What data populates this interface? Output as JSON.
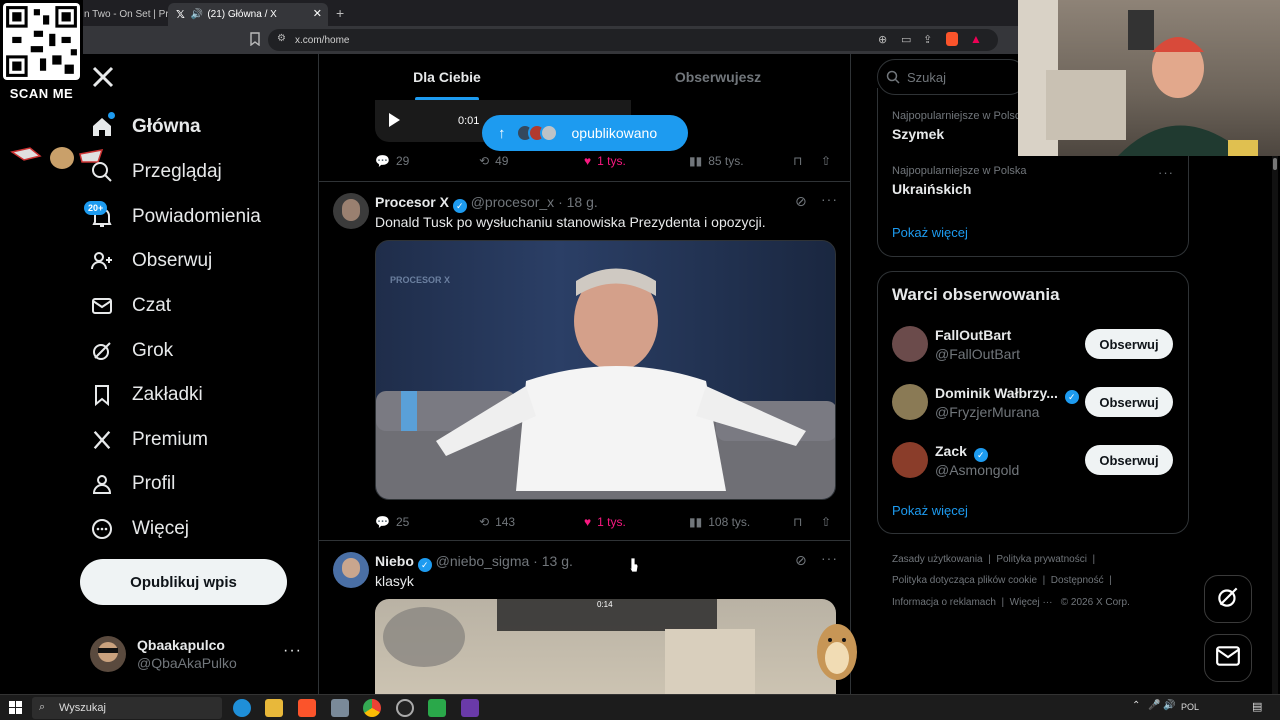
{
  "browser": {
    "tabs": [
      {
        "label": "n Two - On Set | Prin"
      },
      {
        "label": "(21) Główna / X"
      }
    ],
    "url": "x.com/home"
  },
  "overlay": {
    "qr_caption": "SCAN ME"
  },
  "nav": {
    "items": [
      {
        "label": "Główna",
        "icon": "home-icon"
      },
      {
        "label": "Przeglądaj",
        "icon": "search-icon"
      },
      {
        "label": "Powiadomienia",
        "icon": "bell-icon",
        "badge": "20+"
      },
      {
        "label": "Obserwuj",
        "icon": "person-add-icon"
      },
      {
        "label": "Czat",
        "icon": "mail-icon"
      },
      {
        "label": "Grok",
        "icon": "grok-icon"
      },
      {
        "label": "Zakładki",
        "icon": "bookmark-icon"
      },
      {
        "label": "Premium",
        "icon": "x-logo-icon"
      },
      {
        "label": "Profil",
        "icon": "person-icon"
      },
      {
        "label": "Więcej",
        "icon": "more-circle-icon"
      }
    ],
    "post_button": "Opublikuj wpis",
    "account": {
      "name": "Qbaakapulco",
      "handle": "@QbaAkaPulko"
    }
  },
  "feed": {
    "tabs": [
      "Dla Ciebie",
      "Obserwujesz"
    ],
    "new_posts_pill": "opublikowano",
    "audio_time": "0:01",
    "tweets": [
      {
        "replies": "29",
        "reposts": "49",
        "likes": "1 tys.",
        "views": "85 tys."
      },
      {
        "name": "Procesor X",
        "handle": "@procesor_x",
        "time": "18 g.",
        "text": "Donald Tusk po wysłuchaniu stanowiska Prezydenta i opozycji.",
        "watermark": "PROCESOR X",
        "replies": "25",
        "reposts": "143",
        "likes": "1 tys.",
        "views": "108 tys."
      },
      {
        "name": "Niebo",
        "handle": "@niebo_sigma",
        "time": "13 g.",
        "text": "klasyk",
        "game_timer": "0:14"
      }
    ]
  },
  "sidebar": {
    "search_placeholder": "Szukaj",
    "trends": [
      {
        "context": "Najpopularniejsze w Polsce",
        "name": "Szymek"
      },
      {
        "context": "Najpopularniejsze w Polska",
        "name": "Ukraińskich"
      }
    ],
    "show_more": "Pokaż więcej",
    "who_to_follow_title": "Warci obserwowania",
    "who_to_follow": [
      {
        "name": "FallOutBart",
        "handle": "@FallOutBart",
        "verified": false
      },
      {
        "name": "Dominik Wałbrzy...",
        "handle": "@FryzjerMurana",
        "verified": true
      },
      {
        "name": "Zack",
        "handle": "@Asmongold",
        "verified": true
      }
    ],
    "follow_label": "Obserwuj",
    "show_more_2": "Pokaż więcej",
    "footer": {
      "l1": [
        "Zasady użytkowania",
        "Polityka prywatności"
      ],
      "l2": [
        "Polityka dotycząca plików cookie",
        "Dostępność"
      ],
      "l3": [
        "Informacja o reklamach",
        "Więcej ···",
        "© 2026 X Corp."
      ]
    }
  },
  "taskbar": {
    "search": "Wyszukaj",
    "lang": "POL"
  },
  "colors": {
    "accent": "#1d9bf0",
    "like": "#f91880"
  }
}
